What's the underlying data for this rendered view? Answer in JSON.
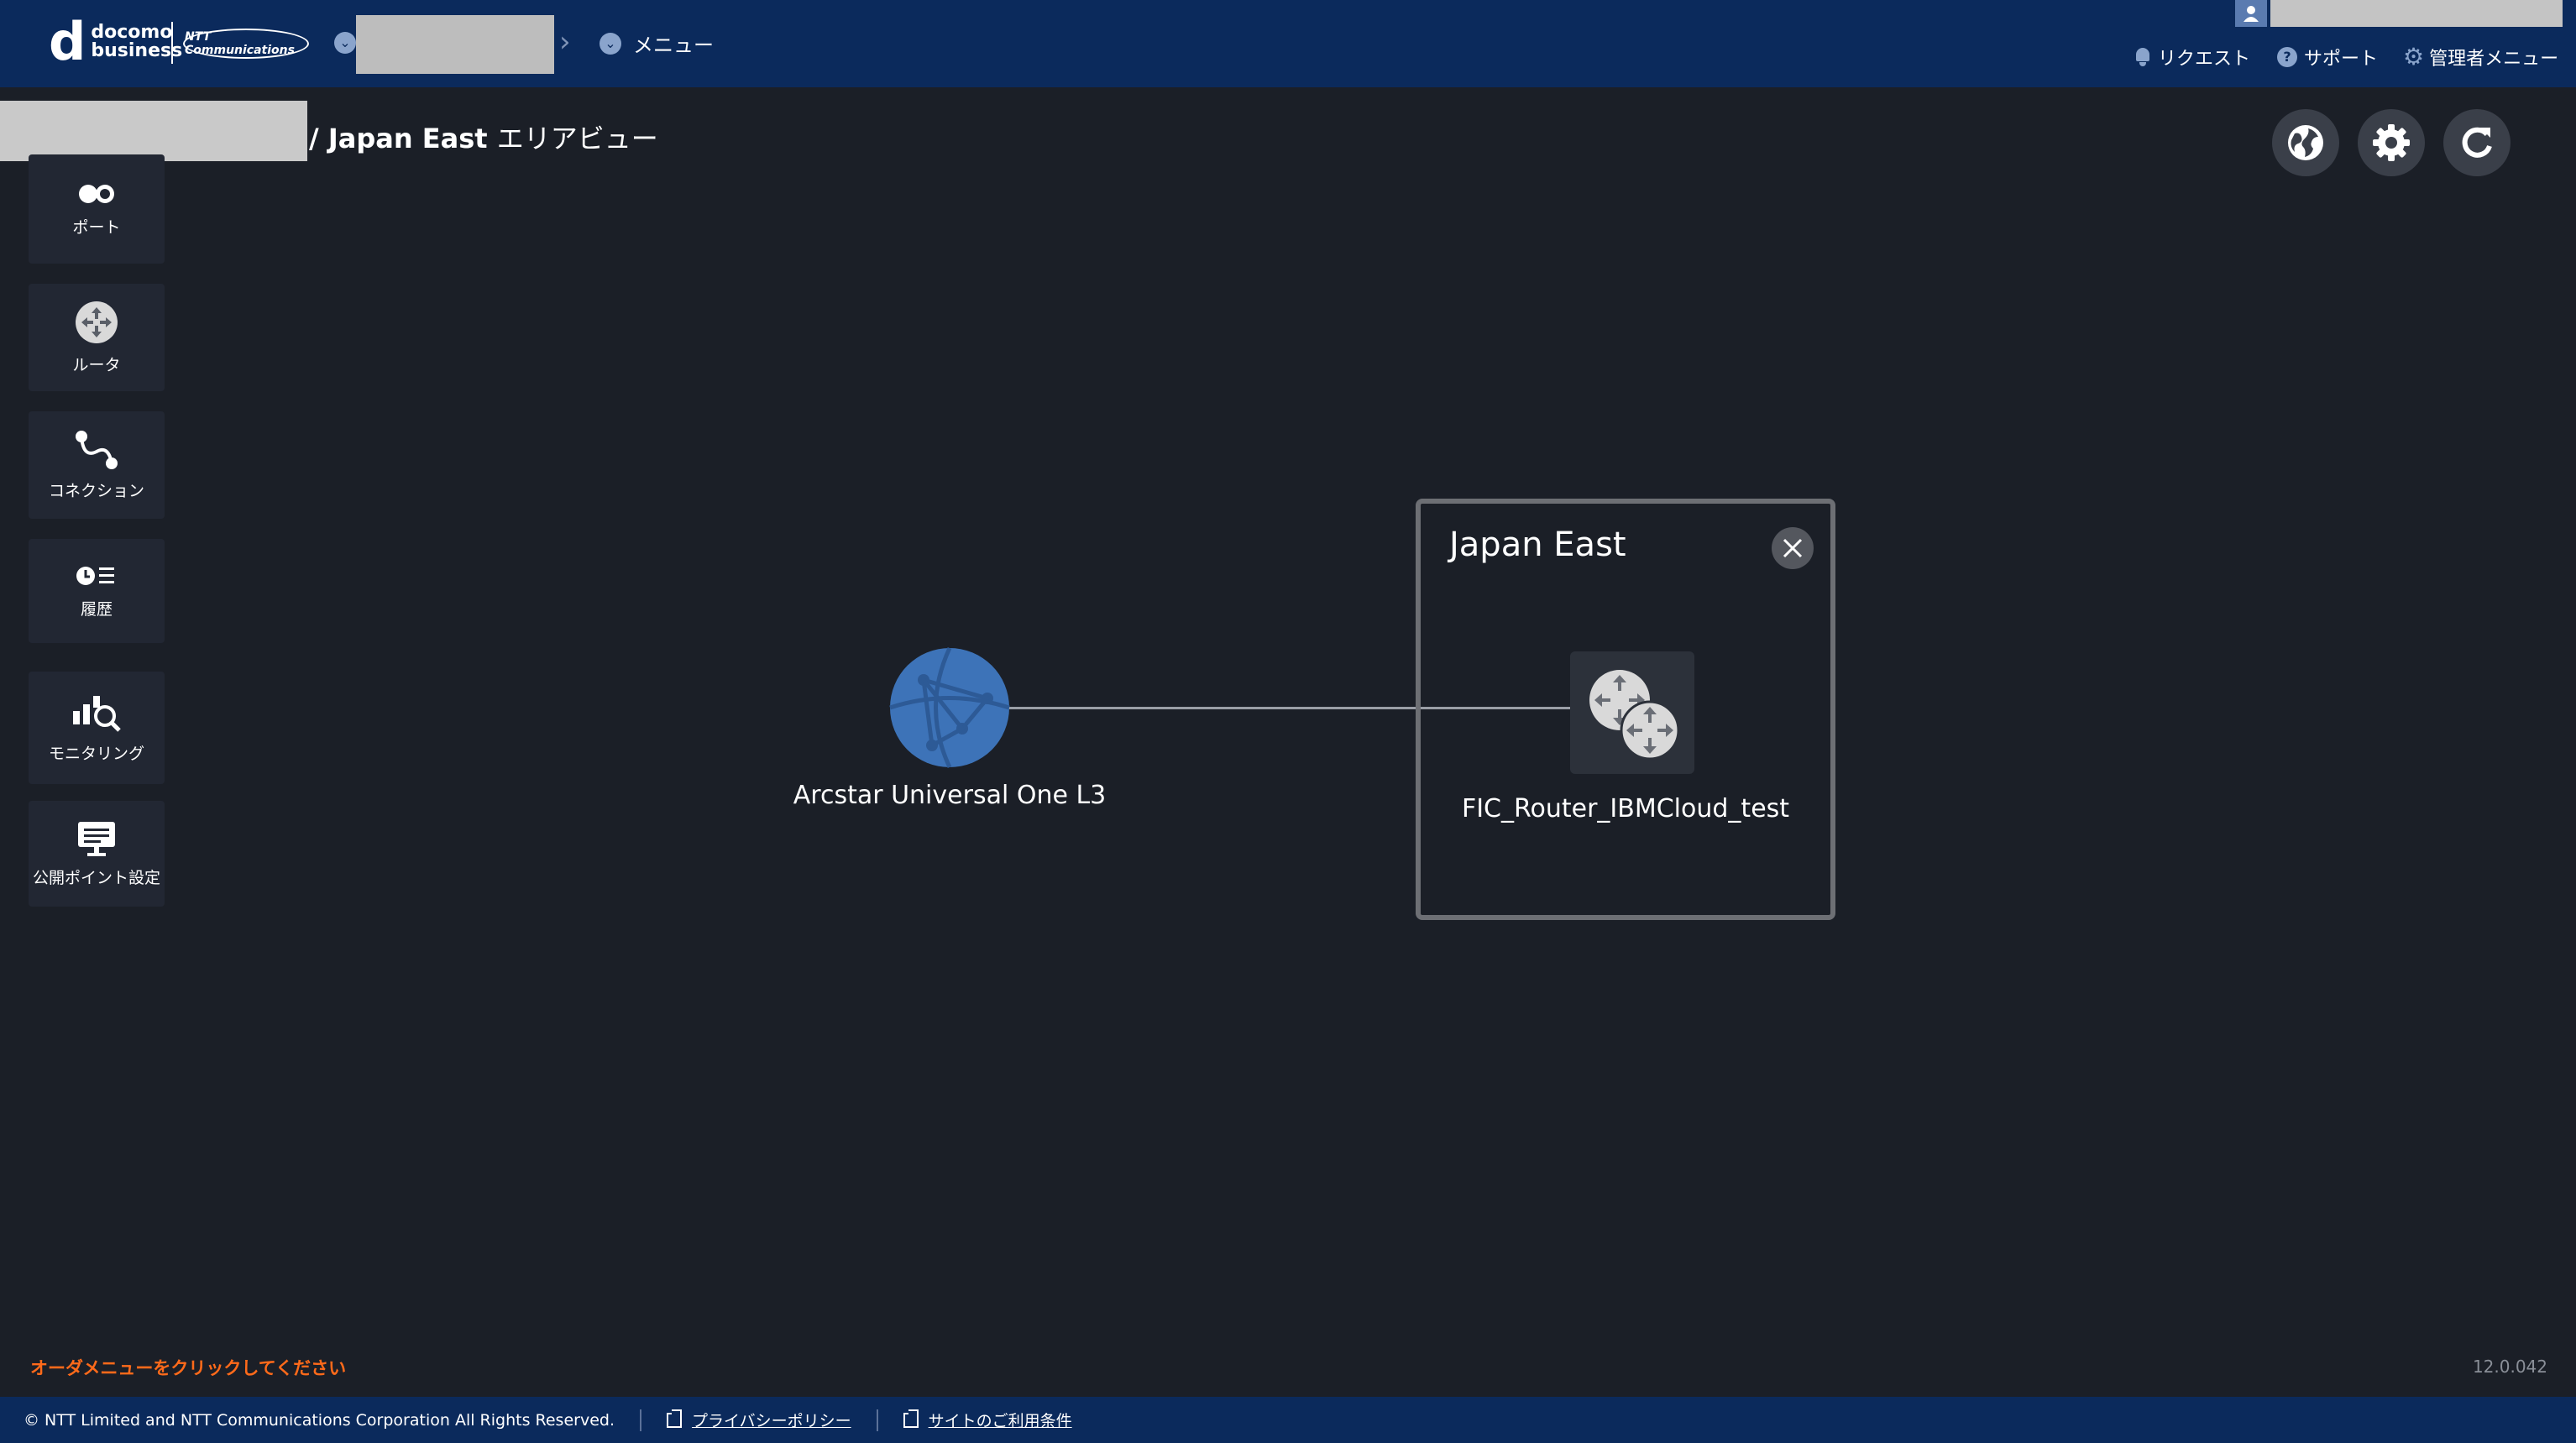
{
  "header": {
    "logo_main": "docomo",
    "logo_sub": "business",
    "logo_partner": "NTT Communications",
    "breadcrumb_menu": "メニュー",
    "nav": [
      {
        "label": "リクエスト",
        "icon": "bell-icon"
      },
      {
        "label": "サポート",
        "icon": "help-icon"
      },
      {
        "label": "管理者メニュー",
        "icon": "gear-icon"
      }
    ]
  },
  "page": {
    "title_area": "/ Japan East",
    "title_suffix": "エリアビュー"
  },
  "sidebar": {
    "items": [
      {
        "label": "ポート",
        "icon": "port-icon"
      },
      {
        "label": "ルータ",
        "icon": "router-icon"
      },
      {
        "label": "コネクション",
        "icon": "connection-icon"
      },
      {
        "label": "履歴",
        "icon": "history-icon"
      },
      {
        "label": "モニタリング",
        "icon": "monitoring-icon"
      },
      {
        "label": "公開ポイント設定",
        "icon": "public-point-icon"
      }
    ]
  },
  "toolbar": {
    "buttons": [
      "globe-icon",
      "settings-icon",
      "refresh-icon"
    ]
  },
  "topology": {
    "network_label": "Arcstar Universal One L3",
    "area_title": "Japan East",
    "router_label": "FIC_Router_IBMCloud_test"
  },
  "bottom": {
    "order_hint": "オーダメニューをクリックしてください",
    "version": "12.0.042"
  },
  "footer": {
    "copyright": "© NTT Limited and NTT Communications Corporation All Rights Reserved.",
    "privacy_link": "プライバシーポリシー",
    "terms_link": "サイトのご利用条件"
  },
  "colors": {
    "header_bg": "#0b2a5c",
    "page_bg": "#1b1f27",
    "accent_orange": "#ff6a1a",
    "globe_blue": "#3d73b8"
  }
}
